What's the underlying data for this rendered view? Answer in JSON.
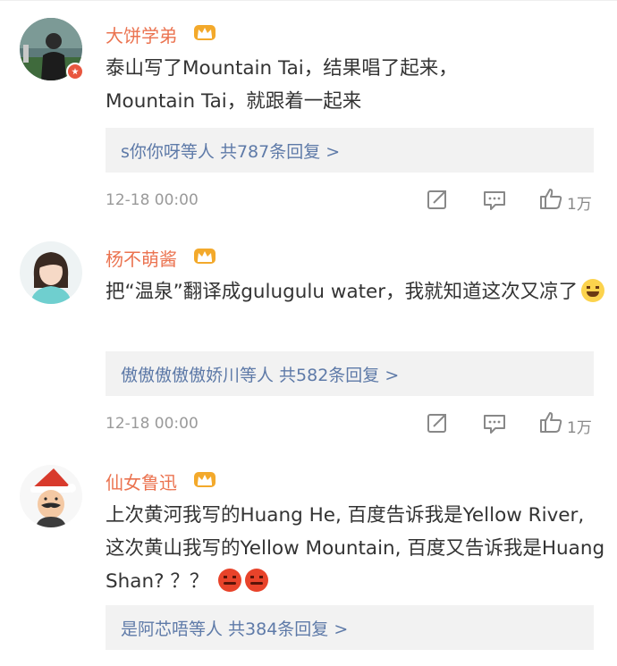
{
  "comments": [
    {
      "username": "大饼学弟",
      "text": "泰山写了Mountain Tai，结果唱了起来，Mountain Tai，就跟着一起来",
      "replies": "s你你呀等人  共787条回复 >",
      "time": "12-18 00:00",
      "likes": "1万"
    },
    {
      "username": "杨不萌酱",
      "text": "把“温泉”翻译成gulugulu water，我就知道这次又凉了",
      "replies": "傲傲傲傲傲娇川等人  共582条回复 >",
      "time": "12-18 00:00",
      "likes": "1万"
    },
    {
      "username": "仙女鲁迅",
      "text": "上次黄河我写的Huang He, 百度告诉我是Yellow River, 这次黄山我写的Yellow Mountain, 百度又告诉我是Huang Shan? ？？",
      "replies": "是阿芯唔等人  共384条回复 >",
      "time": "",
      "likes": ""
    }
  ],
  "icons": {
    "vip_crown": "crown-icon",
    "share": "share-icon",
    "comment": "comment-icon",
    "like": "thumbs-up-icon",
    "laugh_emoji": "laughing-emoji-icon",
    "angry_emoji": "angry-emoji-icon",
    "verified_badge": "verified-badge-icon"
  },
  "colors": {
    "username": "#eb7350",
    "reply_link": "#5e7aa8",
    "reply_bg": "#f2f2f2",
    "meta": "#9a9a9a"
  }
}
